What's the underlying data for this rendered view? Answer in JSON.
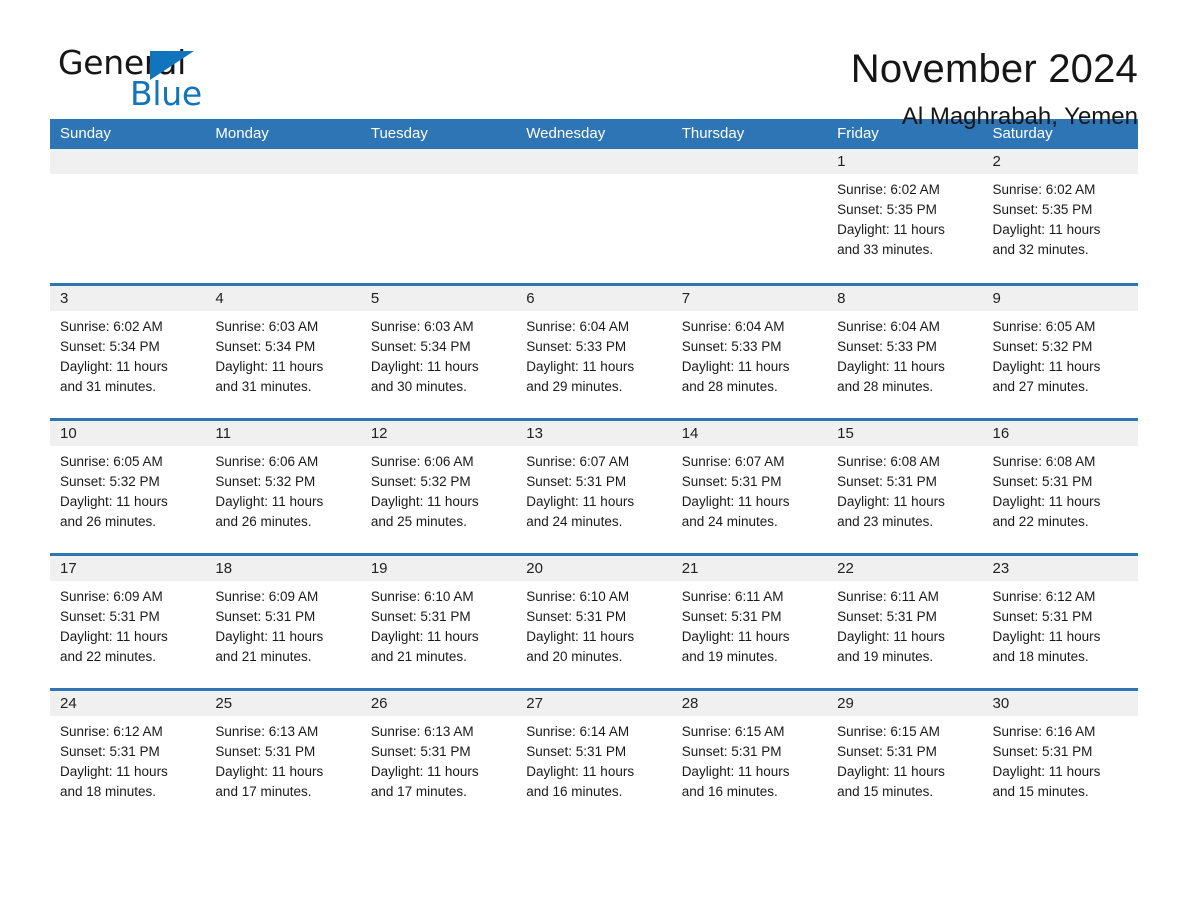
{
  "brand": {
    "name_part1": "General",
    "name_part2": "Blue",
    "logo_icon": "triangle-logo-icon"
  },
  "header": {
    "month_title": "November 2024",
    "location_title": "Al Maghrabah, Yemen"
  },
  "colors": {
    "header_blue": "#2e75b6",
    "logo_blue": "#1274bc",
    "daynum_bg": "#f0f0f0",
    "text": "#1a1a1a"
  },
  "calendar": {
    "weekday_headers": [
      "Sunday",
      "Monday",
      "Tuesday",
      "Wednesday",
      "Thursday",
      "Friday",
      "Saturday"
    ],
    "weeks": [
      [
        {
          "day": "",
          "empty": true
        },
        {
          "day": "",
          "empty": true
        },
        {
          "day": "",
          "empty": true
        },
        {
          "day": "",
          "empty": true
        },
        {
          "day": "",
          "empty": true
        },
        {
          "day": "1",
          "sunrise": "Sunrise: 6:02 AM",
          "sunset": "Sunset: 5:35 PM",
          "daylight_1": "Daylight: 11 hours",
          "daylight_2": "and 33 minutes."
        },
        {
          "day": "2",
          "sunrise": "Sunrise: 6:02 AM",
          "sunset": "Sunset: 5:35 PM",
          "daylight_1": "Daylight: 11 hours",
          "daylight_2": "and 32 minutes."
        }
      ],
      [
        {
          "day": "3",
          "sunrise": "Sunrise: 6:02 AM",
          "sunset": "Sunset: 5:34 PM",
          "daylight_1": "Daylight: 11 hours",
          "daylight_2": "and 31 minutes."
        },
        {
          "day": "4",
          "sunrise": "Sunrise: 6:03 AM",
          "sunset": "Sunset: 5:34 PM",
          "daylight_1": "Daylight: 11 hours",
          "daylight_2": "and 31 minutes."
        },
        {
          "day": "5",
          "sunrise": "Sunrise: 6:03 AM",
          "sunset": "Sunset: 5:34 PM",
          "daylight_1": "Daylight: 11 hours",
          "daylight_2": "and 30 minutes."
        },
        {
          "day": "6",
          "sunrise": "Sunrise: 6:04 AM",
          "sunset": "Sunset: 5:33 PM",
          "daylight_1": "Daylight: 11 hours",
          "daylight_2": "and 29 minutes."
        },
        {
          "day": "7",
          "sunrise": "Sunrise: 6:04 AM",
          "sunset": "Sunset: 5:33 PM",
          "daylight_1": "Daylight: 11 hours",
          "daylight_2": "and 28 minutes."
        },
        {
          "day": "8",
          "sunrise": "Sunrise: 6:04 AM",
          "sunset": "Sunset: 5:33 PM",
          "daylight_1": "Daylight: 11 hours",
          "daylight_2": "and 28 minutes."
        },
        {
          "day": "9",
          "sunrise": "Sunrise: 6:05 AM",
          "sunset": "Sunset: 5:32 PM",
          "daylight_1": "Daylight: 11 hours",
          "daylight_2": "and 27 minutes."
        }
      ],
      [
        {
          "day": "10",
          "sunrise": "Sunrise: 6:05 AM",
          "sunset": "Sunset: 5:32 PM",
          "daylight_1": "Daylight: 11 hours",
          "daylight_2": "and 26 minutes."
        },
        {
          "day": "11",
          "sunrise": "Sunrise: 6:06 AM",
          "sunset": "Sunset: 5:32 PM",
          "daylight_1": "Daylight: 11 hours",
          "daylight_2": "and 26 minutes."
        },
        {
          "day": "12",
          "sunrise": "Sunrise: 6:06 AM",
          "sunset": "Sunset: 5:32 PM",
          "daylight_1": "Daylight: 11 hours",
          "daylight_2": "and 25 minutes."
        },
        {
          "day": "13",
          "sunrise": "Sunrise: 6:07 AM",
          "sunset": "Sunset: 5:31 PM",
          "daylight_1": "Daylight: 11 hours",
          "daylight_2": "and 24 minutes."
        },
        {
          "day": "14",
          "sunrise": "Sunrise: 6:07 AM",
          "sunset": "Sunset: 5:31 PM",
          "daylight_1": "Daylight: 11 hours",
          "daylight_2": "and 24 minutes."
        },
        {
          "day": "15",
          "sunrise": "Sunrise: 6:08 AM",
          "sunset": "Sunset: 5:31 PM",
          "daylight_1": "Daylight: 11 hours",
          "daylight_2": "and 23 minutes."
        },
        {
          "day": "16",
          "sunrise": "Sunrise: 6:08 AM",
          "sunset": "Sunset: 5:31 PM",
          "daylight_1": "Daylight: 11 hours",
          "daylight_2": "and 22 minutes."
        }
      ],
      [
        {
          "day": "17",
          "sunrise": "Sunrise: 6:09 AM",
          "sunset": "Sunset: 5:31 PM",
          "daylight_1": "Daylight: 11 hours",
          "daylight_2": "and 22 minutes."
        },
        {
          "day": "18",
          "sunrise": "Sunrise: 6:09 AM",
          "sunset": "Sunset: 5:31 PM",
          "daylight_1": "Daylight: 11 hours",
          "daylight_2": "and 21 minutes."
        },
        {
          "day": "19",
          "sunrise": "Sunrise: 6:10 AM",
          "sunset": "Sunset: 5:31 PM",
          "daylight_1": "Daylight: 11 hours",
          "daylight_2": "and 21 minutes."
        },
        {
          "day": "20",
          "sunrise": "Sunrise: 6:10 AM",
          "sunset": "Sunset: 5:31 PM",
          "daylight_1": "Daylight: 11 hours",
          "daylight_2": "and 20 minutes."
        },
        {
          "day": "21",
          "sunrise": "Sunrise: 6:11 AM",
          "sunset": "Sunset: 5:31 PM",
          "daylight_1": "Daylight: 11 hours",
          "daylight_2": "and 19 minutes."
        },
        {
          "day": "22",
          "sunrise": "Sunrise: 6:11 AM",
          "sunset": "Sunset: 5:31 PM",
          "daylight_1": "Daylight: 11 hours",
          "daylight_2": "and 19 minutes."
        },
        {
          "day": "23",
          "sunrise": "Sunrise: 6:12 AM",
          "sunset": "Sunset: 5:31 PM",
          "daylight_1": "Daylight: 11 hours",
          "daylight_2": "and 18 minutes."
        }
      ],
      [
        {
          "day": "24",
          "sunrise": "Sunrise: 6:12 AM",
          "sunset": "Sunset: 5:31 PM",
          "daylight_1": "Daylight: 11 hours",
          "daylight_2": "and 18 minutes."
        },
        {
          "day": "25",
          "sunrise": "Sunrise: 6:13 AM",
          "sunset": "Sunset: 5:31 PM",
          "daylight_1": "Daylight: 11 hours",
          "daylight_2": "and 17 minutes."
        },
        {
          "day": "26",
          "sunrise": "Sunrise: 6:13 AM",
          "sunset": "Sunset: 5:31 PM",
          "daylight_1": "Daylight: 11 hours",
          "daylight_2": "and 17 minutes."
        },
        {
          "day": "27",
          "sunrise": "Sunrise: 6:14 AM",
          "sunset": "Sunset: 5:31 PM",
          "daylight_1": "Daylight: 11 hours",
          "daylight_2": "and 16 minutes."
        },
        {
          "day": "28",
          "sunrise": "Sunrise: 6:15 AM",
          "sunset": "Sunset: 5:31 PM",
          "daylight_1": "Daylight: 11 hours",
          "daylight_2": "and 16 minutes."
        },
        {
          "day": "29",
          "sunrise": "Sunrise: 6:15 AM",
          "sunset": "Sunset: 5:31 PM",
          "daylight_1": "Daylight: 11 hours",
          "daylight_2": "and 15 minutes."
        },
        {
          "day": "30",
          "sunrise": "Sunrise: 6:16 AM",
          "sunset": "Sunset: 5:31 PM",
          "daylight_1": "Daylight: 11 hours",
          "daylight_2": "and 15 minutes."
        }
      ]
    ]
  }
}
